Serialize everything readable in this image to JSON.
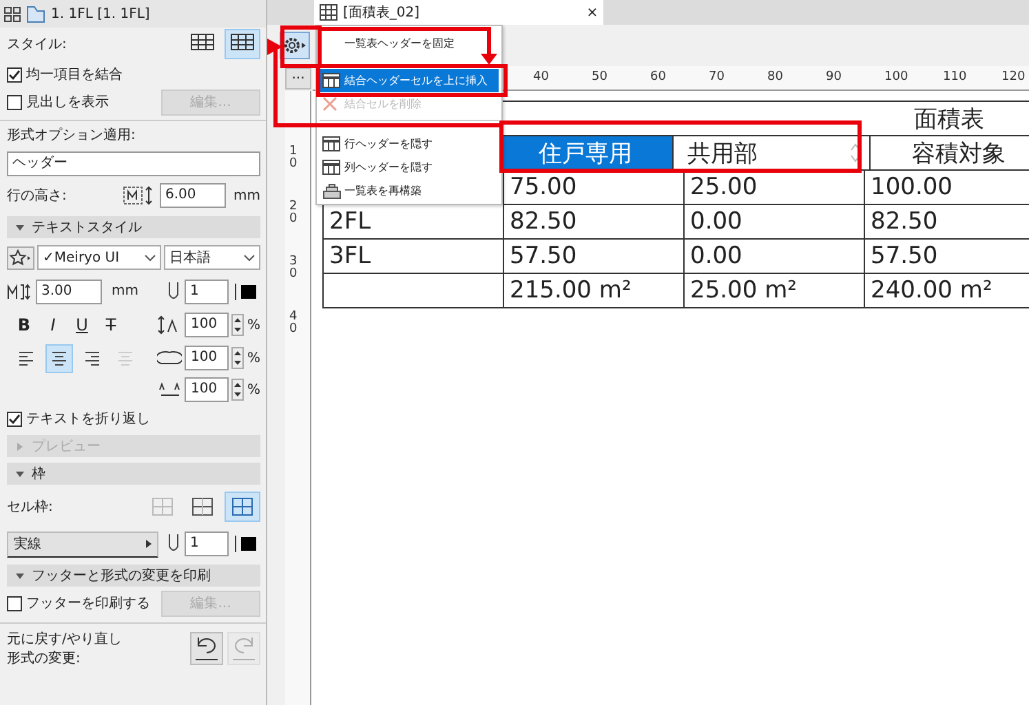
{
  "left_panel": {
    "tab": {
      "label": "1. 1FL [1. 1FL]"
    },
    "rows": [
      {
        "kind": "style",
        "label": "スタイル:",
        "options": [
          {
            "selected": false
          },
          {
            "selected": true
          }
        ]
      },
      {
        "kind": "checkbox",
        "label": "均一項目を結合",
        "checked": true
      },
      {
        "kind": "checkbox",
        "label": "見出しを表示",
        "checked": false,
        "button": {
          "label": "編集...",
          "disabled": true
        }
      },
      {
        "kind": "label",
        "label": "形式オプション適用:"
      },
      {
        "kind": "field",
        "value": "ヘッダー"
      },
      {
        "kind": "row_height",
        "label": "行の高さ:",
        "value": "6.00",
        "unit": "mm"
      },
      {
        "kind": "section",
        "label": "テキストスタイル",
        "expanded": true,
        "disabled": false
      },
      {
        "kind": "font",
        "font": "✓Meiryo UI",
        "language": "日本語"
      },
      {
        "kind": "size_pen",
        "value": "3.00",
        "unit": "mm",
        "pen": "1"
      },
      {
        "kind": "style_spacing",
        "styles": [
          "B",
          "I",
          "U",
          "T"
        ],
        "value": "100",
        "unit": "%"
      },
      {
        "kind": "align_spacing",
        "align": [
          {
            "selected": false,
            "disabled": false
          },
          {
            "selected": true,
            "disabled": false
          },
          {
            "selected": false,
            "disabled": false
          },
          {
            "selected": false,
            "disabled": true
          }
        ],
        "value": "100",
        "unit": "%"
      },
      {
        "kind": "spacing",
        "value": "100",
        "unit": "%"
      },
      {
        "kind": "checkbox",
        "label": "テキストを折り返し",
        "checked": true
      },
      {
        "kind": "section",
        "label": "プレビュー",
        "expanded": false,
        "disabled": true
      },
      {
        "kind": "section",
        "label": "枠",
        "expanded": true,
        "disabled": false
      },
      {
        "kind": "borders",
        "label": "セル枠:",
        "options": [
          {
            "selected": false
          },
          {
            "selected": false
          },
          {
            "selected": true
          }
        ]
      },
      {
        "kind": "line_pen",
        "line": "実線",
        "pen": "1"
      },
      {
        "kind": "section",
        "label": "フッターと形式の変更を印刷",
        "expanded": true,
        "disabled": false
      },
      {
        "kind": "checkbox",
        "label": "フッターを印刷する",
        "checked": false,
        "button": {
          "label": "編集...",
          "disabled": true
        }
      },
      {
        "kind": "undo",
        "lines": [
          "元に戻す/やり直し",
          "形式の変更:"
        ],
        "undo": {
          "disabled": false
        },
        "redo": {
          "disabled": true
        }
      }
    ]
  },
  "schedule": {
    "tab": {
      "label": "[面積表_02]",
      "close": "×"
    },
    "settings_menu": {
      "items": [
        {
          "kind": "item",
          "label": "一覧表ヘッダーを固定",
          "selected": false,
          "disabled": false
        },
        {
          "kind": "item",
          "label": "結合ヘッダーセルを上に挿入",
          "selected": true,
          "disabled": false
        },
        {
          "kind": "item",
          "label": "結合セルを削除",
          "selected": false,
          "disabled": true
        },
        {
          "kind": "separator"
        },
        {
          "kind": "item",
          "label": "行ヘッダーを隠す",
          "selected": false,
          "disabled": false
        },
        {
          "kind": "item",
          "label": "列ヘッダーを隠す",
          "selected": false,
          "disabled": false
        },
        {
          "kind": "item",
          "label": "一覧表を再構築",
          "selected": false,
          "disabled": false
        }
      ]
    },
    "ruler": {
      "more": "...",
      "x_labels": [
        "40",
        "50",
        "60",
        "70",
        "80",
        "90",
        "100",
        "110",
        "120"
      ],
      "y_labels": [
        "10",
        "20",
        "30",
        "40"
      ]
    },
    "table": {
      "title": "面積表",
      "columns": [
        {},
        {
          "label": "住戸専用",
          "selected": true,
          "editing": false
        },
        {
          "label": "共用部",
          "selected": false,
          "editing": true
        },
        {
          "label": "容積対象",
          "selected": false,
          "editing": false
        }
      ],
      "rows": [
        [
          null,
          "75.00",
          "25.00",
          "100.00"
        ],
        [
          "2FL",
          "82.50",
          "0.00",
          "82.50"
        ],
        [
          "3FL",
          "57.50",
          "0.00",
          "57.50"
        ],
        [
          null,
          "215.00 m²",
          "25.00 m²",
          "240.00 m²"
        ]
      ]
    }
  }
}
